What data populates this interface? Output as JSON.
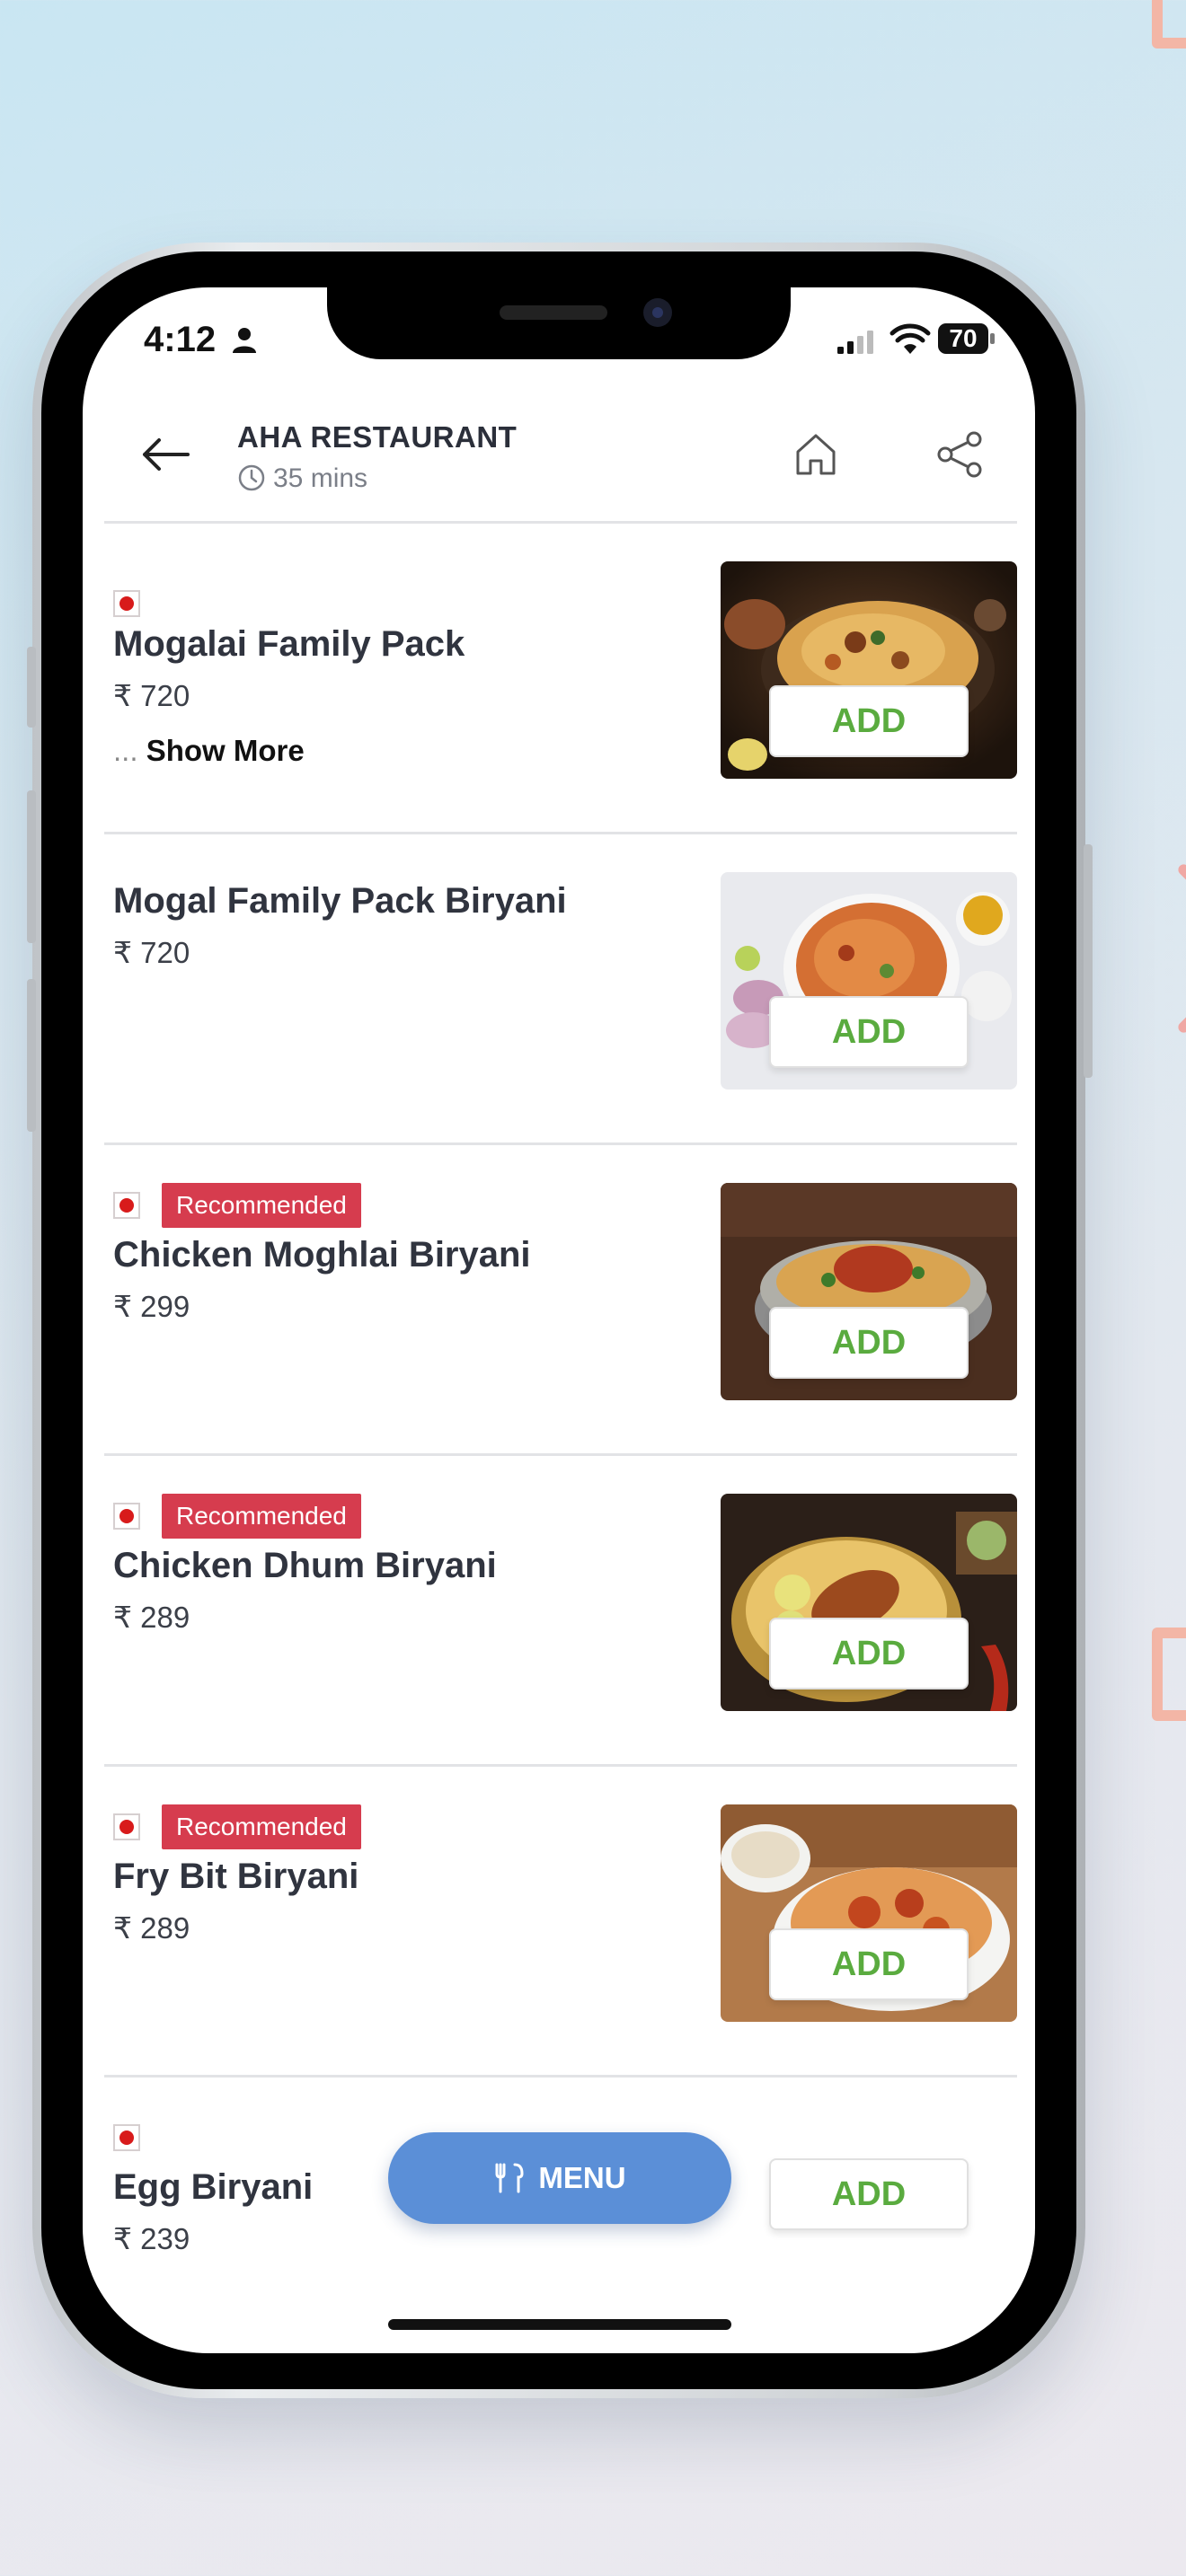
{
  "status_bar": {
    "time": "4:12",
    "battery": "70"
  },
  "header": {
    "restaurant_name": "AHA RESTAURANT",
    "eta": "35 mins"
  },
  "items": [
    {
      "name": "Mogalai Family Pack",
      "price": "₹ 720",
      "badge": "",
      "show_more_prefix": "...",
      "show_more": "Show More",
      "add_label": "ADD"
    },
    {
      "name": "Mogal Family Pack Biryani",
      "price": "₹ 720",
      "badge": "",
      "add_label": "ADD"
    },
    {
      "name": "Chicken Moghlai Biryani",
      "price": "₹ 299",
      "badge": "Recommended",
      "add_label": "ADD"
    },
    {
      "name": "Chicken Dhum Biryani",
      "price": "₹ 289",
      "badge": "Recommended",
      "add_label": "ADD"
    },
    {
      "name": "Fry Bit Biryani",
      "price": "₹ 289",
      "badge": "Recommended",
      "add_label": "ADD"
    },
    {
      "name": "Egg Biryani",
      "price": "₹ 239",
      "badge": "",
      "add_label": "ADD"
    }
  ],
  "menu_button": {
    "label": "MENU"
  },
  "colors": {
    "add_text": "#5aab3f",
    "badge_bg": "#d63c4e",
    "menu_bg": "#5b8fd7",
    "nonveg_dot": "#d81b1b"
  }
}
